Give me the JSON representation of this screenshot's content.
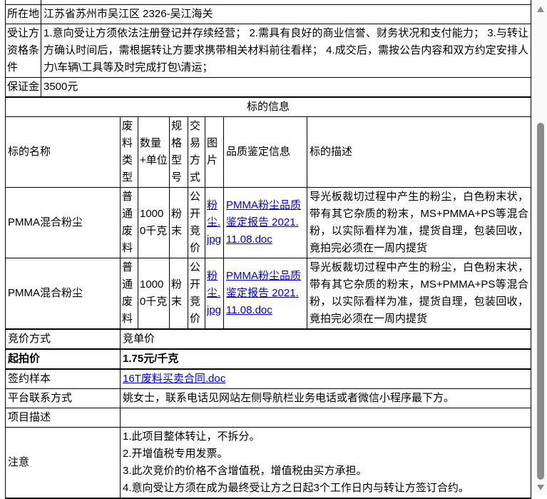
{
  "colors": {
    "link": "#0000EE",
    "border": "#000000",
    "scrollbar_thumb": "#8b8b8b",
    "scrollbar_track": "#fafafa"
  },
  "info_table": {
    "rows": [
      {
        "label": "所在地",
        "value": "江苏省苏州市吴江区 2326-吴江海关"
      },
      {
        "label": "受让方资格条件",
        "value": "1.意向受让方须依法注册登记并存续经营； 2.需具有良好的商业信誉、财务状况和支付能力； 3.与转让方确认时间后，需根据转让方要求携带相关材料前往看样； 4.成交后，需按公告内容和双方约定安排人力\\车辆\\工具等及时完成打包\\清运；"
      },
      {
        "label": "保证金",
        "value": "3500元"
      }
    ]
  },
  "subject_table": {
    "title": "标的信息",
    "headers": {
      "name": "标的名称",
      "waste_type": "废料类型",
      "quantity": "数量+单位",
      "spec": "规格型号",
      "trade_mode": "交易方式",
      "image": "图片",
      "quality_info": "品质鉴定信息",
      "description": "标的描述"
    },
    "items": [
      {
        "name": "PMMA混合粉尘",
        "waste_type": "普通废料",
        "quantity": "10000千克",
        "spec": "粉末",
        "trade_mode": "公开竞价",
        "image_link": "粉尘.jpg",
        "quality_link": "PMMA粉尘品质鉴定报告 2021.11.08.doc",
        "description": "导光板裁切过程中产生的粉尘，白色粉末状，带有其它杂质的粉末，MS+PMMA+PS等混合粉，以实际看样为准，提货自理，包装回收，竟拍完必须在一周内提货"
      },
      {
        "name": "PMMA混合粉尘",
        "waste_type": "普通废料",
        "quantity": "10000千克",
        "spec": "粉末",
        "trade_mode": "公开竞价",
        "image_link": "粉尘.jpg",
        "quality_link": "PMMA粉尘品质鉴定报告 2021.11.08.doc",
        "description": "导光板裁切过程中产生的粉尘，白色粉末状，带有其它杂质的粉末，MS+PMMA+PS等混合粉，以实际看样为准，提货自理，包装回收，竟拍完必须在一周内提货"
      }
    ]
  },
  "detail_table": {
    "bid_mode": {
      "label": "竞价方式",
      "value": "竞单价"
    },
    "start_price": {
      "label": "起拍价",
      "value": "1.75元/千克"
    },
    "contract_sample": {
      "label": "签约样本",
      "link": "16T废料买卖合同.doc"
    },
    "platform_contact": {
      "label": "平台联系方式",
      "value": "姚女士，联系电话见网站左侧导航栏业务电话或者微信小程序最下方。"
    },
    "project_desc": {
      "label": "项目描述",
      "value": ""
    },
    "notes": {
      "label": "注意",
      "items": [
        "1.此项目整体转让，不拆分。",
        "2.开增值税专用发票。",
        "3.此次竞价的价格不含增值税，增值税由买方承担。",
        "4.意向受让方须在成为最终受让方之日起3个工作日内与转让方签订合约。"
      ]
    }
  }
}
